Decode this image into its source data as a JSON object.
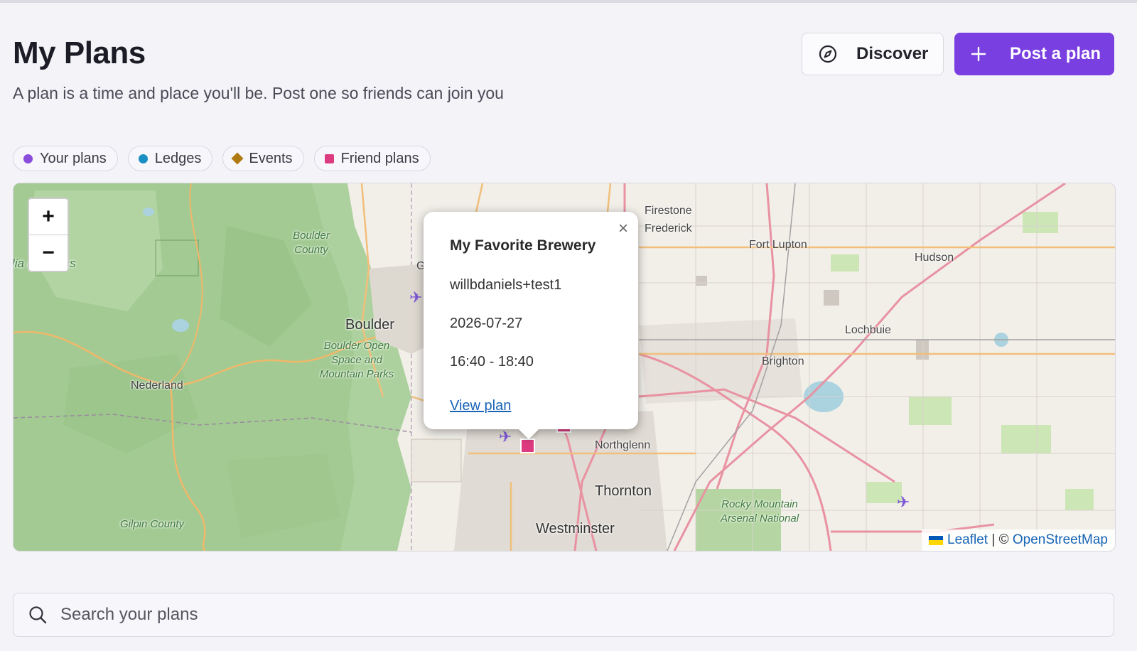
{
  "header": {
    "title": "My Plans",
    "subtitle": "A plan is a time and place you'll be. Post one so friends can join you",
    "discover_label": "Discover",
    "post_label": "Post a plan",
    "accent_color": "#7a3fe0"
  },
  "legend": [
    {
      "label": "Your plans",
      "shape": "circle",
      "color": "#8b4ddb"
    },
    {
      "label": "Ledges",
      "shape": "circle",
      "color": "#1a8fc4"
    },
    {
      "label": "Events",
      "shape": "diamond",
      "color": "#b07a12"
    },
    {
      "label": "Friend plans",
      "shape": "square",
      "color": "#dd3b80"
    }
  ],
  "map": {
    "zoom_in": "+",
    "zoom_out": "−",
    "places": {
      "firestone": "Firestone",
      "frederick": "Frederick",
      "fort_lupton": "Fort Lupton",
      "hudson": "Hudson",
      "lochbuie": "Lochbuie",
      "brighton": "Brighton",
      "boulder": "Boulder",
      "nederland": "Nederland",
      "northglenn": "Northglenn",
      "thornton": "Thornton",
      "westminster": "Westminster",
      "boulder_county": "Boulder County",
      "boulder_open_space": "Boulder Open Space and Mountain Parks",
      "gilpin_county": "Gilpin County",
      "rocky_mountain_arsenal": "Rocky Mountain Arsenal National",
      "wilderness": "lia ilderness",
      "g_partial": "G"
    },
    "popup": {
      "title": "My Favorite Brewery",
      "user": "willbdaniels+test1",
      "date": "2026-07-27",
      "time": "16:40 - 18:40",
      "link": "View plan",
      "close": "×"
    },
    "attribution": {
      "leaflet": "Leaflet",
      "separator": " | © ",
      "osm": "OpenStreetMap"
    }
  },
  "search": {
    "placeholder": "Search your plans"
  }
}
